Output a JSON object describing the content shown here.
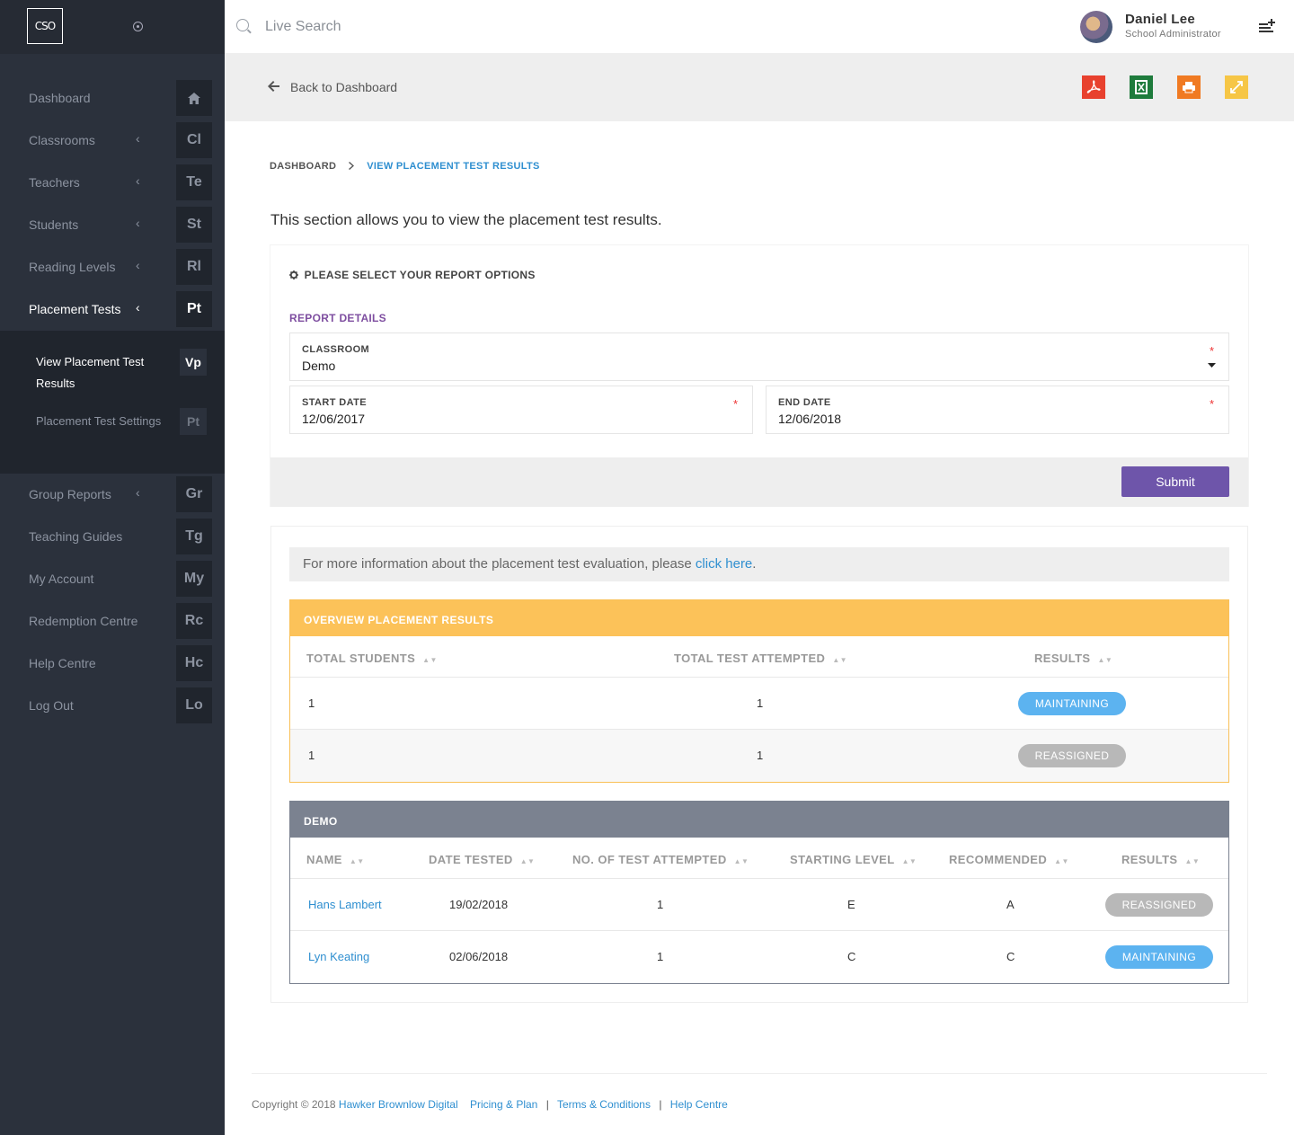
{
  "app": {
    "logo_text": "CSO"
  },
  "topbar": {
    "search_placeholder": "Live Search",
    "user_name": "Daniel Lee",
    "user_role": "School Administrator"
  },
  "sidebar": {
    "items": [
      {
        "label": "Dashboard",
        "abbr": "",
        "icon": "home-icon"
      },
      {
        "label": "Classrooms",
        "abbr": "Cl"
      },
      {
        "label": "Teachers",
        "abbr": "Te"
      },
      {
        "label": "Students",
        "abbr": "St"
      },
      {
        "label": "Reading Levels",
        "abbr": "Rl"
      },
      {
        "label": "Placement Tests",
        "abbr": "Pt"
      },
      {
        "label": "Group Reports",
        "abbr": "Gr"
      },
      {
        "label": "Teaching Guides",
        "abbr": "Tg"
      },
      {
        "label": "My Account",
        "abbr": "My"
      },
      {
        "label": "Redemption Centre",
        "abbr": "Rc"
      },
      {
        "label": "Help Centre",
        "abbr": "Hc"
      },
      {
        "label": "Log Out",
        "abbr": "Lo"
      }
    ],
    "sub_items": [
      {
        "label": "View Placement Test Results",
        "abbr": "Vp"
      },
      {
        "label": "Placement Test Settings",
        "abbr": "Pt"
      }
    ]
  },
  "header": {
    "back_label": "Back to Dashboard",
    "exports": [
      {
        "icon": "pdf-icon",
        "color": "#e8412e"
      },
      {
        "icon": "excel-icon",
        "color": "#1e7b3c"
      },
      {
        "icon": "print-icon",
        "color": "#f07a22"
      },
      {
        "icon": "expand-icon",
        "color": "#f6c646"
      }
    ]
  },
  "breadcrumb": {
    "home": "DASHBOARD",
    "current": "VIEW PLACEMENT TEST RESULTS"
  },
  "intro": "This section allows you to view the placement test results.",
  "options": {
    "title": "PLEASE SELECT YOUR REPORT OPTIONS",
    "section": "REPORT DETAILS",
    "classroom_label": "CLASSROOM",
    "classroom_value": "Demo",
    "start_label": "START DATE",
    "start_value": "12/06/2017",
    "end_label": "END DATE",
    "end_value": "12/06/2018",
    "required_mark": "*",
    "submit_label": "Submit"
  },
  "info": {
    "text": "For more information about the placement test evaluation, please ",
    "link": "click here",
    "end": "."
  },
  "overview": {
    "title": "OVERVIEW PLACEMENT RESULTS",
    "columns": [
      "TOTAL STUDENTS",
      "TOTAL TEST ATTEMPTED",
      "RESULTS"
    ],
    "rows": [
      {
        "total_students": "1",
        "total_attempted": "1",
        "result": "MAINTAINING"
      },
      {
        "total_students": "1",
        "total_attempted": "1",
        "result": "REASSIGNED"
      }
    ]
  },
  "demo": {
    "title": "DEMO",
    "columns": [
      "NAME",
      "DATE TESTED",
      "NO. OF TEST ATTEMPTED",
      "STARTING LEVEL",
      "RECOMMENDED",
      "RESULTS"
    ],
    "rows": [
      {
        "name": "Hans Lambert",
        "date": "19/02/2018",
        "attempted": "1",
        "starting": "E",
        "recommended": "A",
        "result": "REASSIGNED"
      },
      {
        "name": "Lyn Keating",
        "date": "02/06/2018",
        "attempted": "1",
        "starting": "C",
        "recommended": "C",
        "result": "MAINTAINING"
      }
    ]
  },
  "footer": {
    "copyright": "Copyright © 2018",
    "company": "Hawker Brownlow Digital",
    "links": [
      "Pricing & Plan",
      "Terms & Conditions",
      "Help Centre"
    ],
    "separator": "|"
  }
}
